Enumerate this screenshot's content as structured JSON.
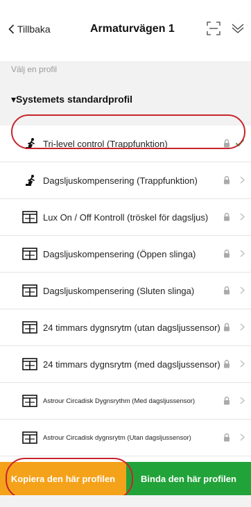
{
  "header": {
    "back_label": "Tillbaka",
    "title": "Armaturvägen 1",
    "icons": [
      "scan-icon",
      "chevron-double-down-icon"
    ]
  },
  "section": {
    "subtitle": "Välj en profil",
    "group_title": "▾Systemets standardprofil"
  },
  "profiles": [
    {
      "label": "Tri-level control (Trappfunktion)",
      "icon": "stairs-runner-icon",
      "selected": true
    },
    {
      "label": "Dagsljuskompensering (Trappfunktion)",
      "icon": "stairs-runner-icon",
      "selected": false
    },
    {
      "label": "Lux On / Off Kontroll (tröskel för dagsljus)",
      "icon": "window-sensor-icon",
      "selected": false
    },
    {
      "label": "Dagsljuskompensering (Öppen slinga)",
      "icon": "window-sensor-icon",
      "selected": false
    },
    {
      "label": "Dagsljuskompensering (Sluten slinga)",
      "icon": "window-sensor-icon",
      "selected": false
    },
    {
      "label": "24 timmars dygnsrytm (utan dagsljussensor)",
      "icon": "window-sensor-icon",
      "selected": false
    },
    {
      "label": "24 timmars dygnsrytm (med dagsljussensor)",
      "icon": "window-sensor-icon",
      "selected": false
    },
    {
      "label": "Astrour Circadisk Dygnsrythm (Med dagsljussensor)",
      "icon": "window-sensor-icon",
      "selected": false
    },
    {
      "label": "Astrour Circadisk dygnsrytm (Utan dagsljussensor)",
      "icon": "window-sensor-icon",
      "selected": false
    }
  ],
  "footer": {
    "copy_label": "Kopiera den här profilen",
    "bind_label": "Binda den här profilen"
  },
  "colors": {
    "copy_button": "#f5a21b",
    "bind_button": "#22a33a",
    "highlight": "#c8232c",
    "check": "#22a33a"
  }
}
